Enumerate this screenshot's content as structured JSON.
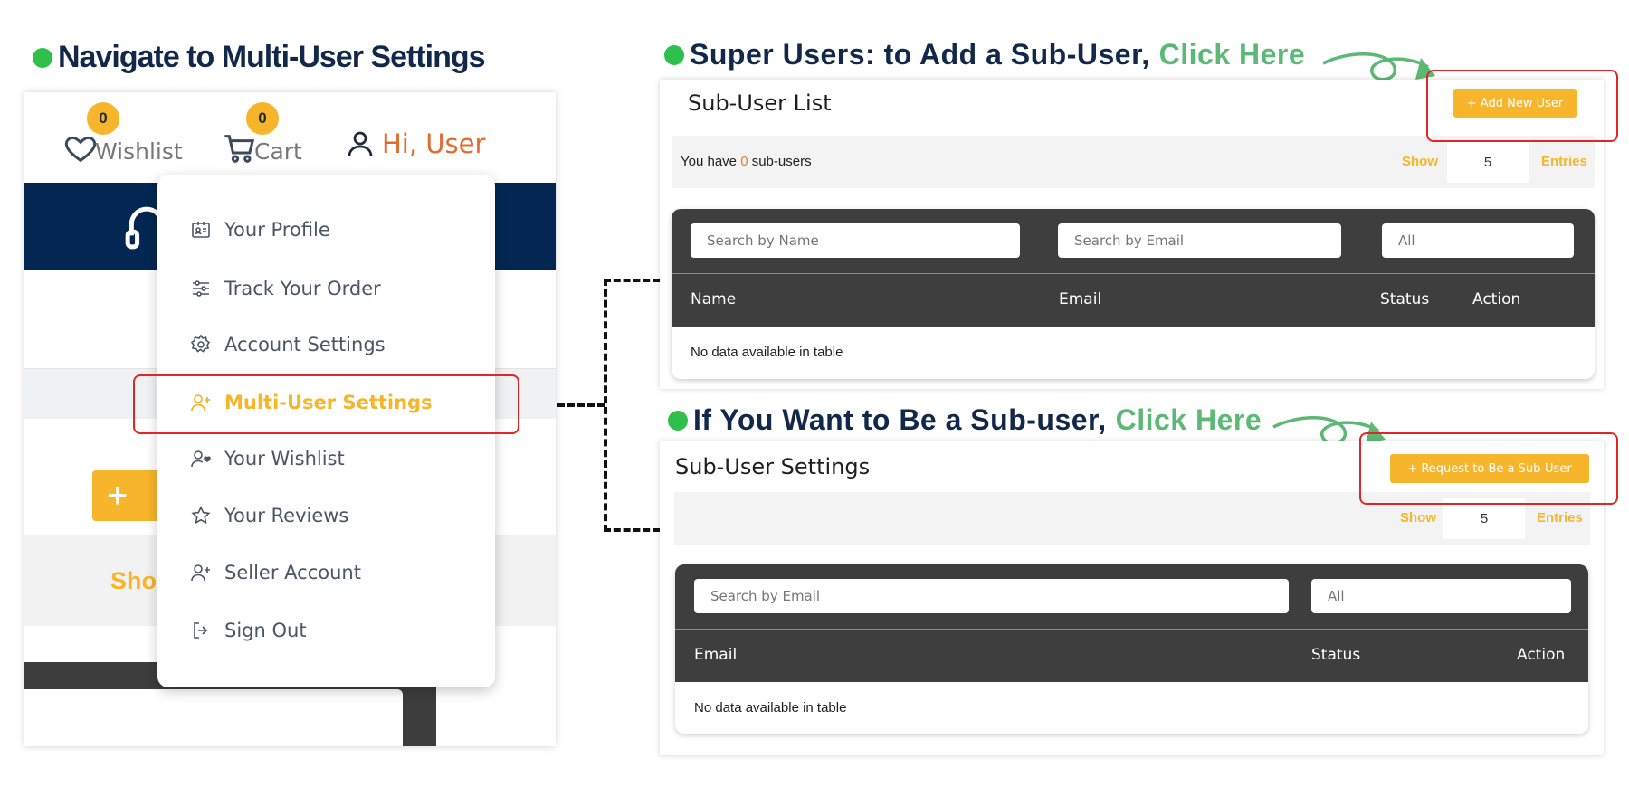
{
  "headings": {
    "navigate": "Navigate to Multi-User Settings",
    "super_users": "Super Users: to Add a Sub-User,",
    "super_users_click": "Click Here",
    "want_sub": "If You Want to Be a Sub-user,",
    "want_sub_click": "Click Here"
  },
  "header": {
    "wishlist_label": "Wishlist",
    "wishlist_count": "0",
    "cart_label": "Cart",
    "cart_count": "0",
    "greeting": "Hi, User"
  },
  "background": {
    "show_label": "Show"
  },
  "menu": {
    "items": [
      {
        "label": "Your Profile",
        "icon": "profile-card-icon"
      },
      {
        "label": "Track Your Order",
        "icon": "sliders-icon"
      },
      {
        "label": "Account Settings",
        "icon": "gear-icon"
      },
      {
        "label": "Multi-User Settings",
        "icon": "user-plus-icon"
      },
      {
        "label": "Your Wishlist",
        "icon": "user-heart-icon"
      },
      {
        "label": "Your Reviews",
        "icon": "star-icon"
      },
      {
        "label": "Seller Account",
        "icon": "user-plus-icon"
      },
      {
        "label": "Sign Out",
        "icon": "sign-out-icon"
      }
    ],
    "active_index": 3
  },
  "sub_user_list": {
    "title": "Sub-User List",
    "add_button": "+ Add New User",
    "count_prefix": "You have",
    "count": "0",
    "count_suffix": "sub-users",
    "show_label": "Show",
    "entries_value": "5",
    "entries_label": "Entries",
    "search_name_placeholder": "Search by Name",
    "search_email_placeholder": "Search by Email",
    "status_filter": "All",
    "columns": [
      "Name",
      "Email",
      "Status",
      "Action"
    ],
    "empty_message": "No data available in table"
  },
  "sub_user_settings": {
    "title": "Sub-User Settings",
    "request_button": "+ Request to Be a Sub-User",
    "show_label": "Show",
    "entries_value": "5",
    "entries_label": "Entries",
    "search_email_placeholder": "Search by Email",
    "status_filter": "All",
    "columns": [
      "Email",
      "Status",
      "Action"
    ],
    "empty_message": "No data available in table"
  },
  "colors": {
    "navy": "#12284a",
    "accent_yellow": "#f6b52b",
    "highlight_green": "#5cb975",
    "callout_red": "#e0262b",
    "header_band": "#032752",
    "table_dark": "#3e3e3e"
  }
}
